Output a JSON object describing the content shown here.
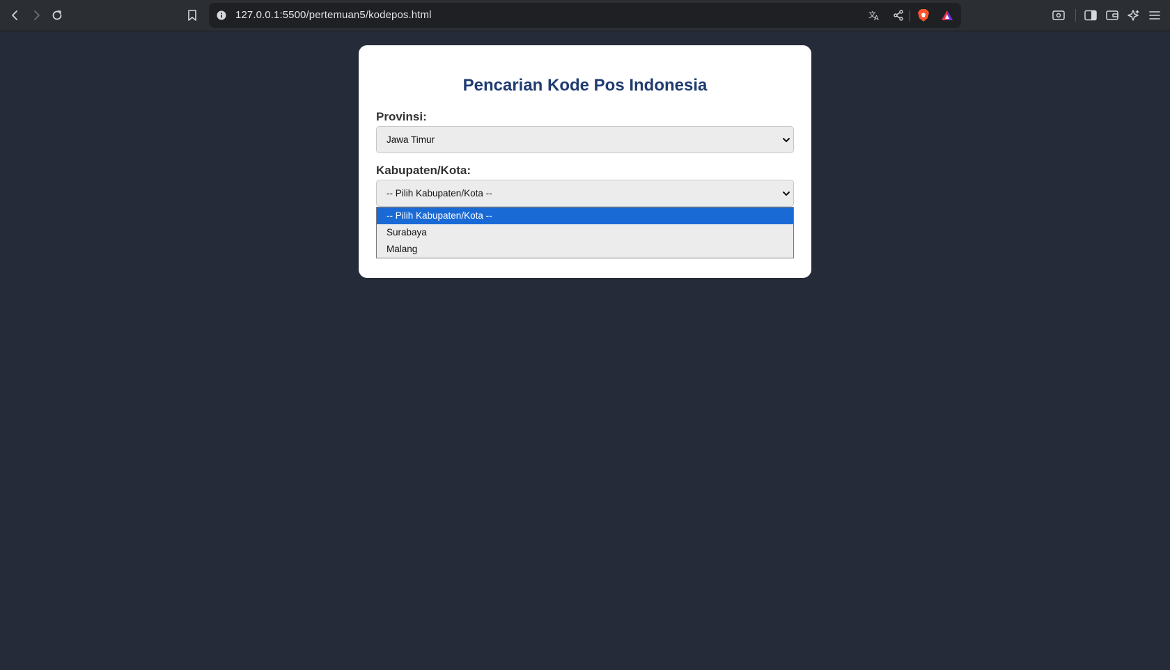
{
  "browser": {
    "url": "127.0.0.1:5500/pertemuan5/kodepos.html",
    "icons": {
      "back": "back-arrow-icon",
      "forward": "forward-arrow-icon",
      "reload": "reload-icon",
      "bookmark": "bookmark-icon",
      "info": "site-info-icon",
      "translate": "translate-icon",
      "share": "share-icon",
      "brave_shields": "brave-lion-icon",
      "rewards": "brave-rewards-triangle-icon",
      "screenshot": "screenshot-icon",
      "sidebar": "sidebar-icon",
      "wallet": "wallet-icon",
      "leo": "leo-ai-icon",
      "menu": "hamburger-menu-icon"
    }
  },
  "page": {
    "title": "Pencarian Kode Pos Indonesia",
    "provinsi_label": "Provinsi:",
    "provinsi_value": "Jawa Timur",
    "kabupaten_label": "Kabupaten/Kota:",
    "kabupaten_value": "-- Pilih Kabupaten/Kota --",
    "kabupaten_options": [
      {
        "label": "-- Pilih Kabupaten/Kota --",
        "selected": true
      },
      {
        "label": "Surabaya",
        "selected": false
      },
      {
        "label": "Malang",
        "selected": false
      }
    ]
  },
  "colors": {
    "background": "#252b38",
    "card": "#ffffff",
    "title": "#1f3b70",
    "option_highlight": "#1a6ad6"
  }
}
